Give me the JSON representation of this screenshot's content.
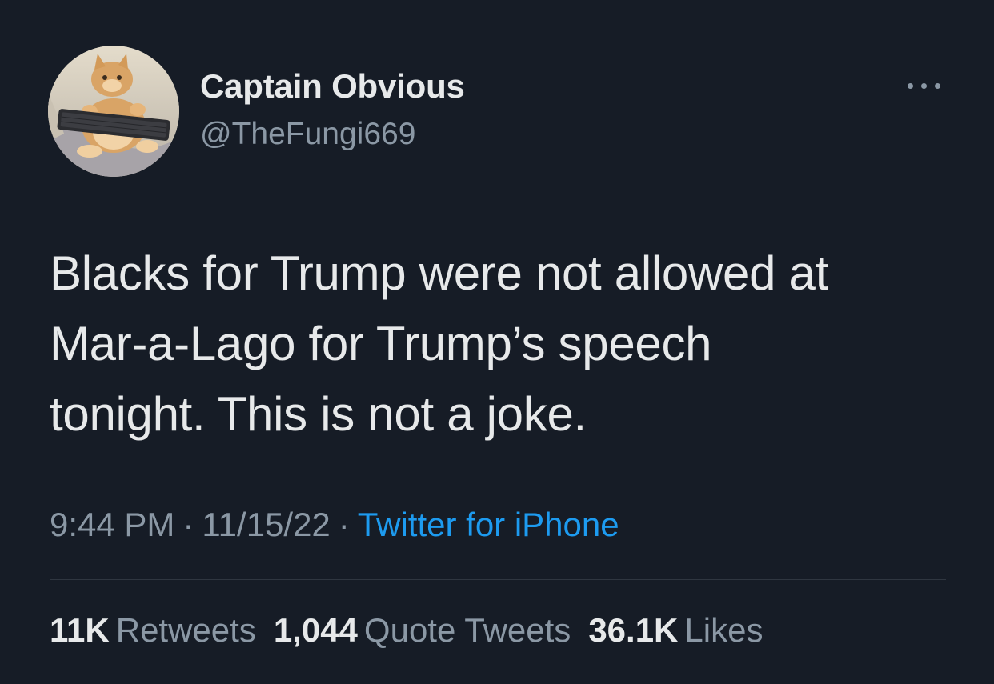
{
  "author": {
    "display_name": "Captain Obvious",
    "handle": "@TheFungi669",
    "avatar_icon": "cat-with-keyboard-avatar"
  },
  "more_icon": "more-horizontal-icon",
  "tweet": {
    "text_lines": [
      "Blacks for Trump were not allowed at",
      "Mar-a-Lago for Trump’s speech",
      "tonight. This is not a joke."
    ],
    "time": "9:44 PM",
    "separator": "·",
    "date": "11/15/22",
    "source": "Twitter for iPhone"
  },
  "stats": {
    "retweets": {
      "count": "11K",
      "label": "Retweets"
    },
    "quotes": {
      "count": "1,044",
      "label": "Quote Tweets"
    },
    "likes": {
      "count": "36.1K",
      "label": "Likes"
    }
  },
  "colors": {
    "background": "#161c26",
    "text": "#e7e9ea",
    "muted": "#8b98a5",
    "link": "#1d9bf0"
  }
}
